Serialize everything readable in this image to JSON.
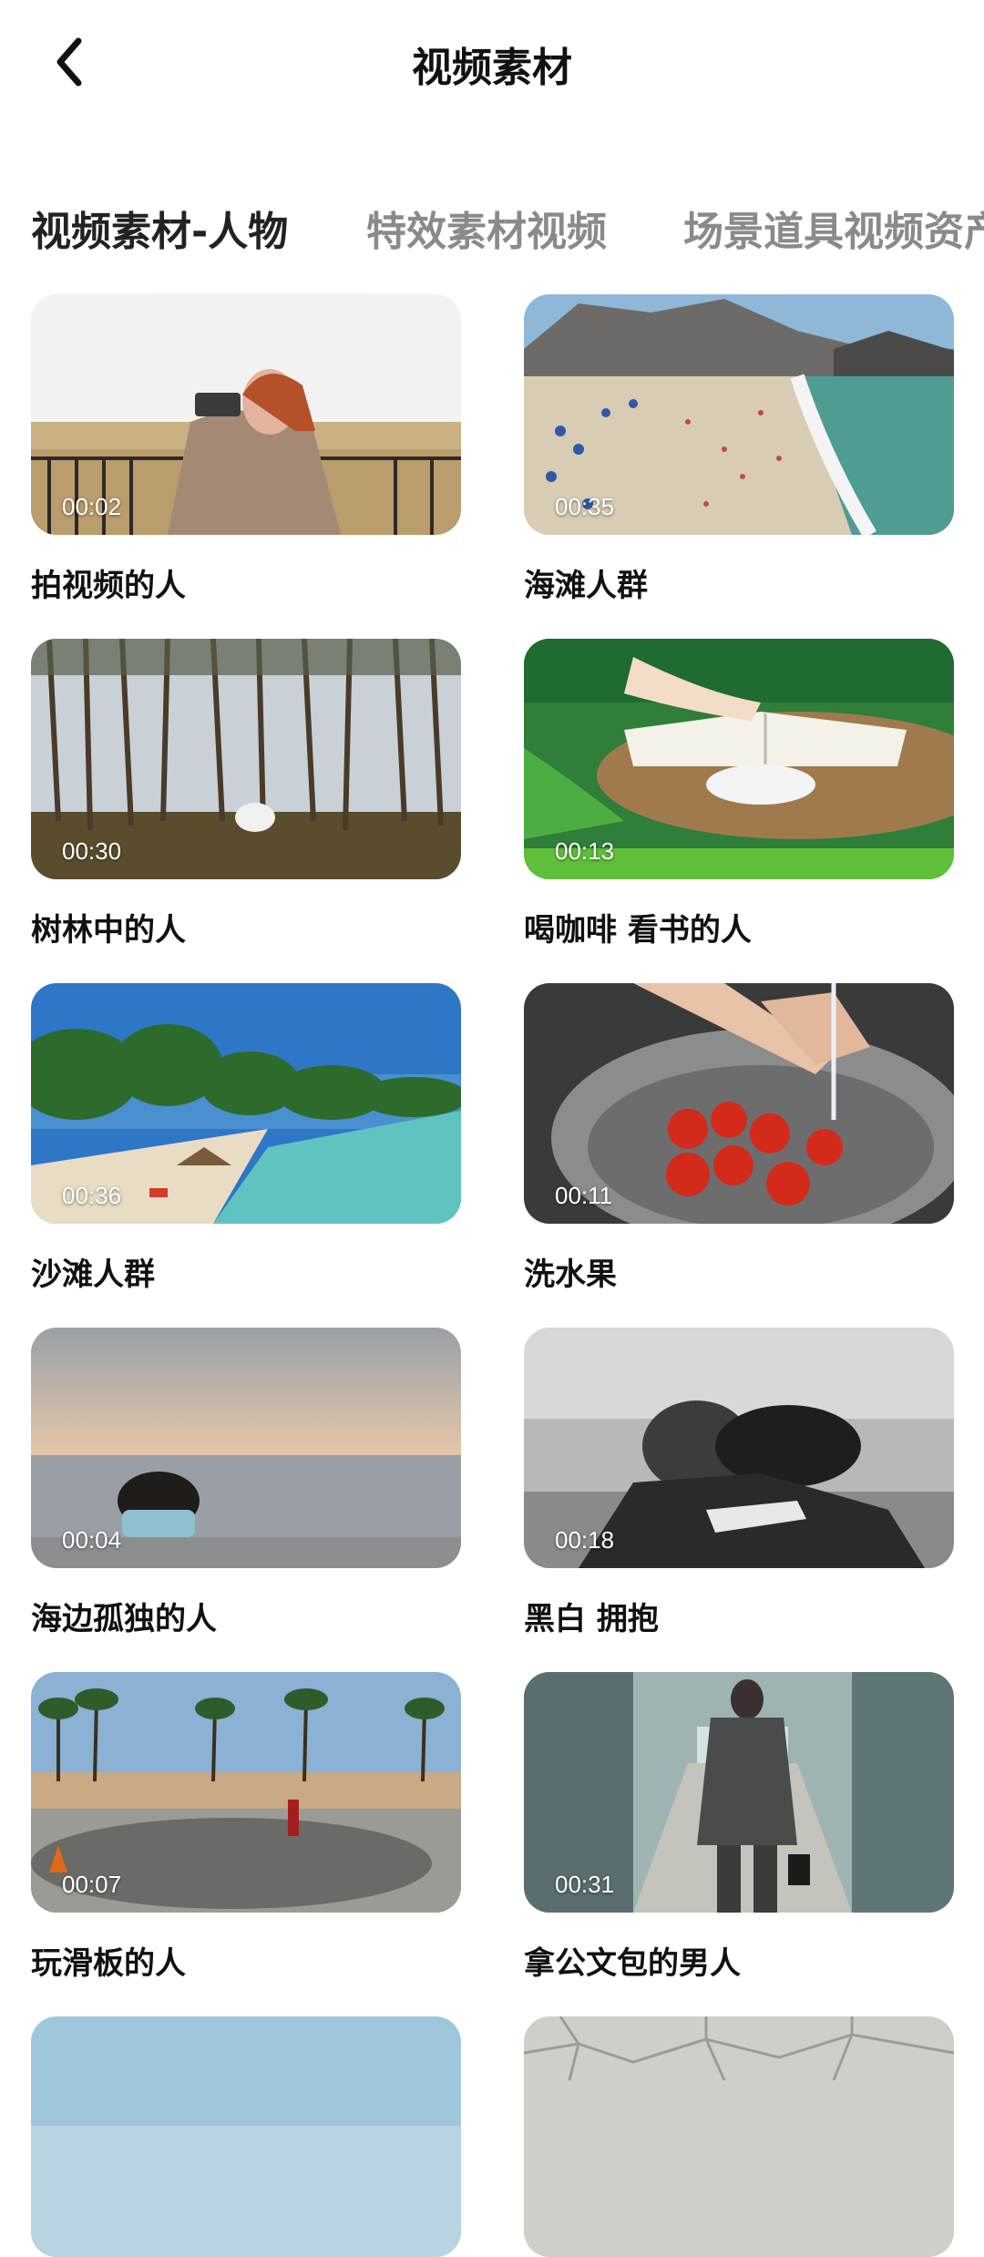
{
  "header": {
    "title": "视频素材"
  },
  "tabs": [
    {
      "label": "视频素材-人物",
      "active": true
    },
    {
      "label": "特效素材视频",
      "active": false
    },
    {
      "label": "场景道具视频资产",
      "active": false
    }
  ],
  "items": [
    {
      "title": "拍视频的人",
      "duration": "00:02",
      "thumb": "woman-camera"
    },
    {
      "title": "海滩人群",
      "duration": "00:35",
      "thumb": "beach-crowd-aerial"
    },
    {
      "title": "树林中的人",
      "duration": "00:30",
      "thumb": "pine-forest"
    },
    {
      "title": "喝咖啡 看书的人",
      "duration": "00:13",
      "thumb": "coffee-book"
    },
    {
      "title": "沙滩人群",
      "duration": "00:36",
      "thumb": "palm-beach"
    },
    {
      "title": "洗水果",
      "duration": "00:11",
      "thumb": "washing-tomatoes"
    },
    {
      "title": "海边孤独的人",
      "duration": "00:04",
      "thumb": "lonely-seaside"
    },
    {
      "title": "黑白 拥抱",
      "duration": "00:18",
      "thumb": "bw-hug"
    },
    {
      "title": "玩滑板的人",
      "duration": "00:07",
      "thumb": "skatepark"
    },
    {
      "title": "拿公文包的男人",
      "duration": "00:31",
      "thumb": "businessman-briefcase"
    },
    {
      "title": "",
      "duration": "",
      "thumb": "sky-partial"
    },
    {
      "title": "",
      "duration": "",
      "thumb": "cracked-earth-partial"
    }
  ]
}
